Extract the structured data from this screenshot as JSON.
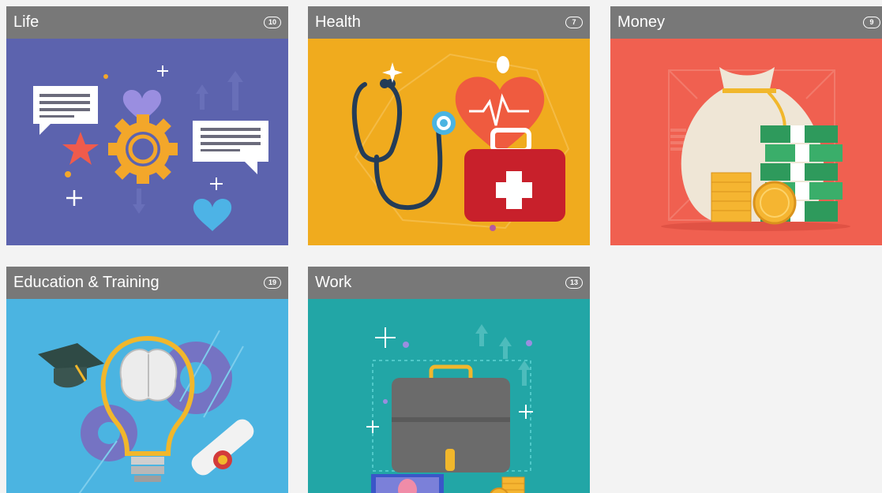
{
  "categories": [
    {
      "title": "Life",
      "count": "10",
      "background": "#5c63ae"
    },
    {
      "title": "Health",
      "count": "7",
      "background": "#f0ab1e"
    },
    {
      "title": "Money",
      "count": "9",
      "background": "#f06050"
    },
    {
      "title": "Education & Training",
      "count": "19",
      "background": "#4bb4e1"
    },
    {
      "title": "Work",
      "count": "13",
      "background": "#22a6a6"
    }
  ],
  "colors": {
    "header": "#787878",
    "page_background": "#f3f3f3"
  }
}
